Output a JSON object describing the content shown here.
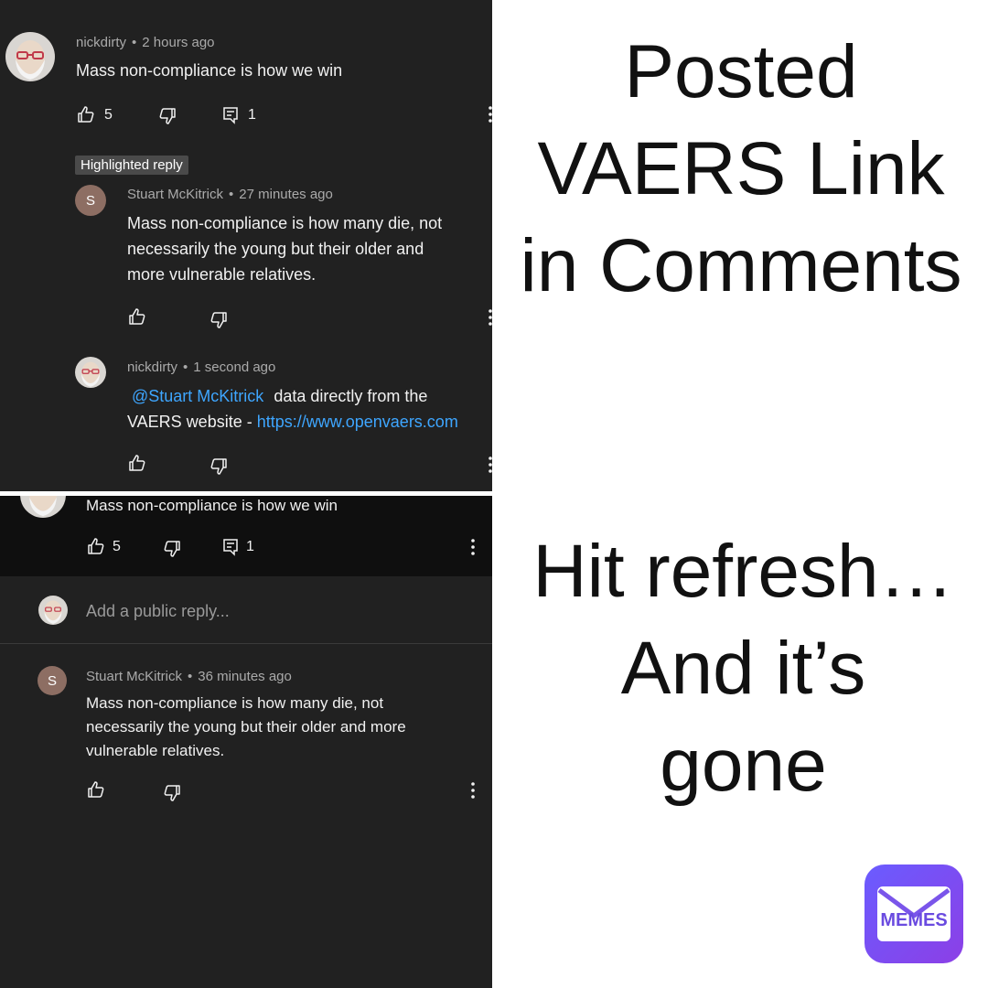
{
  "top_panel": {
    "comment": {
      "author": "nickdirty",
      "time": "2 hours ago",
      "text": "Mass non-compliance is how we win",
      "likes": "5",
      "replies": "1"
    },
    "highlighted_label": "Highlighted reply",
    "reply1": {
      "avatar_letter": "S",
      "author": "Stuart McKitrick",
      "time": "27 minutes ago",
      "text_lines": [
        "Mass non-compliance is how many die, not",
        "necessarily the young but their older and",
        "more vulnerable relatives."
      ]
    },
    "reply2": {
      "author": "nickdirty",
      "time": "1 second ago",
      "mention": "@Stuart McKitrick",
      "text_after_mention": "data directly from the",
      "line2_text": "VAERS website - ",
      "link": "https://www.openvaers.com"
    }
  },
  "bottom_panel": {
    "comment": {
      "text": "Mass non-compliance is how we win",
      "likes": "5",
      "replies": "1"
    },
    "reply_input": {
      "placeholder": "Add a public reply..."
    },
    "reply": {
      "avatar_letter": "S",
      "author": "Stuart McKitrick",
      "time": "36 minutes ago",
      "text_lines": [
        "Mass non-compliance is how many die, not",
        "necessarily the young but their older and more",
        "vulnerable relatives."
      ]
    }
  },
  "captions": {
    "top": [
      "Posted",
      "VAERS Link",
      "in Comments"
    ],
    "bottom": [
      "Hit refresh…",
      "And it’s",
      "gone"
    ]
  },
  "watermark": {
    "text": "MEMES"
  },
  "icons": {
    "like": "thumbs-up-icon",
    "dislike": "thumbs-down-icon",
    "reply": "comment-reply-icon",
    "more": "more-vertical-icon"
  },
  "colors": {
    "panel_bg": "#212121",
    "link": "#3ea6ff",
    "meta": "#aaaaaa",
    "text": "#f1f1f1",
    "avatar_s": "#8d6e63"
  }
}
